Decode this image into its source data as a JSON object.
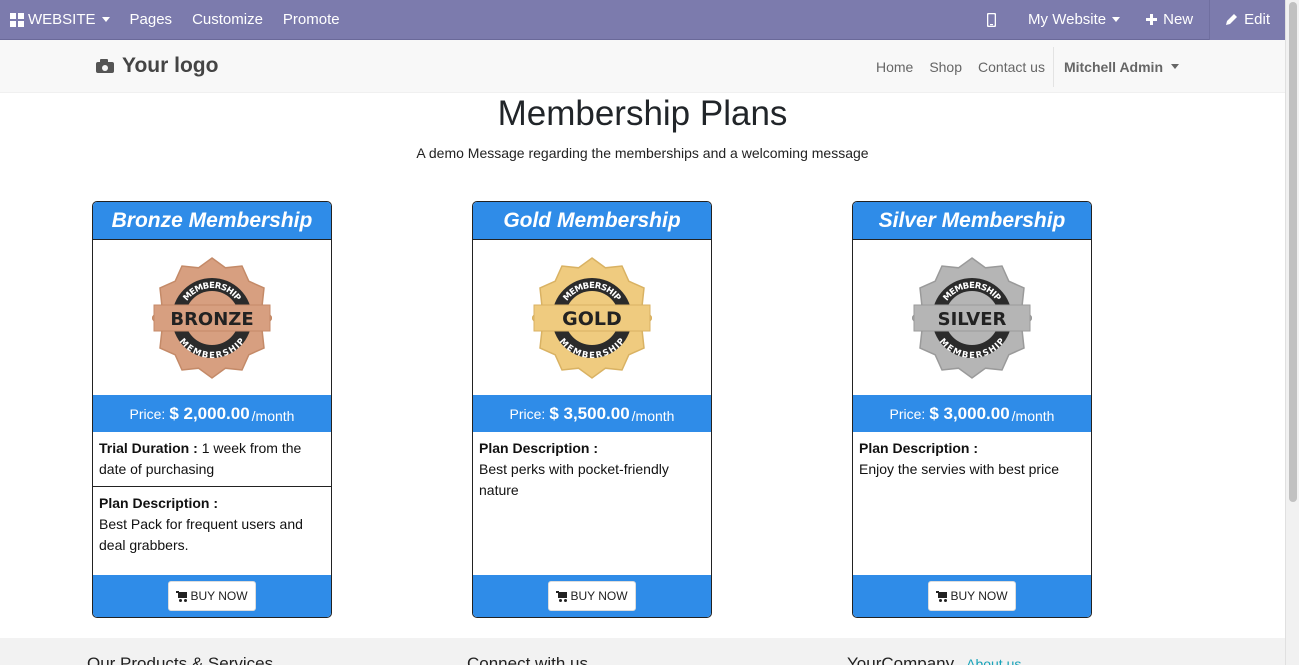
{
  "adminbar": {
    "app_label": "WEBSITE",
    "menu": [
      "Pages",
      "Customize",
      "Promote"
    ],
    "website_switcher": "My Website",
    "new_label": "New",
    "edit_label": "Edit"
  },
  "header": {
    "logo_text": "Your logo",
    "nav": [
      "Home",
      "Shop",
      "Contact us"
    ],
    "user": "Mitchell Admin"
  },
  "page": {
    "title": "Membership Plans",
    "subtitle": "A demo Message regarding the memberships and a welcoming message"
  },
  "cards": [
    {
      "title": "Bronze Membership",
      "badge_text": "BRONZE",
      "badge_ring_text": "MEMBERSHIP",
      "badge_color": "#d79f80",
      "badge_accent": "#c48a68",
      "price_label": "Price:",
      "price": "$ 2,000.00",
      "period": "/month",
      "trial_label": "Trial Duration :",
      "trial_value": "1 week from the date of purchasing",
      "desc_label": "Plan Description :",
      "desc_value": "Best Pack for frequent users and deal grabbers.",
      "buy_label": "BUY NOW"
    },
    {
      "title": "Gold Membership",
      "badge_text": "GOLD",
      "badge_ring_text": "MEMBERSHIP",
      "badge_color": "#efcb7f",
      "badge_accent": "#d9b263",
      "price_label": "Price:",
      "price": "$ 3,500.00",
      "period": "/month",
      "desc_label": "Plan Description :",
      "desc_value": "Best perks with pocket-friendly nature",
      "buy_label": "BUY NOW"
    },
    {
      "title": "Silver Membership",
      "badge_text": "SILVER",
      "badge_ring_text": "MEMBERSHIP",
      "badge_color": "#b5b5b5",
      "badge_accent": "#9a9a9a",
      "price_label": "Price:",
      "price": "$ 3,000.00",
      "period": "/month",
      "desc_label": "Plan Description :",
      "desc_value": "Enjoy the servies with best price",
      "buy_label": "BUY NOW"
    }
  ],
  "footer": {
    "col1": "Our Products & Services",
    "col2": "Connect with us",
    "col3": "YourCompany",
    "about": "About us"
  },
  "colors": {
    "adminbar": "#7c7bad",
    "card_blue": "#2f8ce8"
  }
}
